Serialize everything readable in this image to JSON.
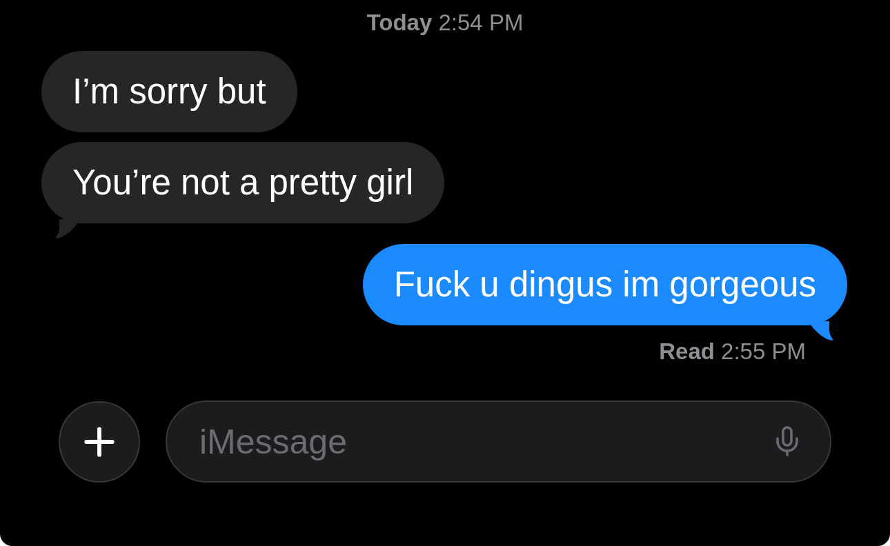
{
  "timestamp": "**Today** 2:54 PM",
  "messages": [
    {
      "kind": "incoming",
      "text": "I’m sorry but",
      "tail": false
    },
    {
      "kind": "incoming",
      "text": "You’re not a pretty girl",
      "tail": true
    },
    {
      "kind": "outgoing",
      "text": "Fuck u dingus im gorgeous",
      "tail": true
    }
  ],
  "receipt": "**Read** 2:55 PM",
  "composer": {
    "placeholder": "iMessage"
  }
}
